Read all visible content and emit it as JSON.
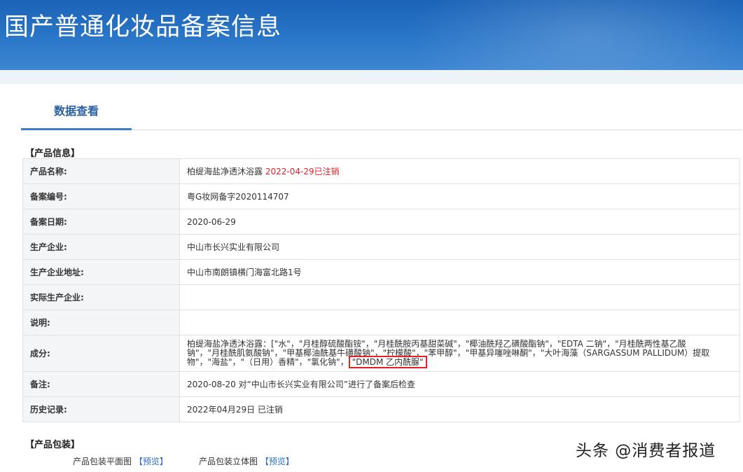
{
  "header": {
    "title": "国产普通化妆品备案信息"
  },
  "tabs": [
    {
      "label": "数据查看"
    }
  ],
  "product_info": {
    "section_title": "【产品信息】",
    "rows": [
      {
        "label": "产品名称:",
        "value": "柏缇海盐净透沐浴露",
        "status": "2022-04-29已注销"
      },
      {
        "label": "备案编号:",
        "value": "粤G妆网备字2020114707"
      },
      {
        "label": "备案日期:",
        "value": "2020-06-29"
      },
      {
        "label": "生产企业:",
        "value": "中山市长兴实业有限公司"
      },
      {
        "label": "生产企业地址:",
        "value": "中山市南朗镇横门海富北路1号"
      },
      {
        "label": "实际生产企业:",
        "value": ""
      },
      {
        "label": "说明:",
        "value": ""
      },
      {
        "label": "成分:",
        "value": "柏缇海盐净透沐浴露：[\"水\"，\"月桂醇硫酸酯铵\"，\"月桂酰胺丙基甜菜碱\"，\"椰油酰羟乙磺酸酯钠\"，\"EDTA 二钠\"，\"月桂酰两性基乙酸钠\"，\"月桂酰肌氨酸钠\"，\"甲基椰油酰基牛磺酸钠\"，\"柠檬酸\"，\"苯甲醇\"，\"甲基异噻唑啉酮\"，\"大叶海藻（SARGASSUM PALLIDUM）提取物\"，\"海盐\"，\"（日用）香精\"，\"氯化钠\"，",
        "highlight": "\"DMDM 乙内酰脲\""
      },
      {
        "label": "备注:",
        "value": "2020-08-20 对“中山市长兴实业有限公司”进行了备案后检查"
      },
      {
        "label": "历史记录:",
        "value": "2022年04月29日 已注销"
      }
    ]
  },
  "packaging": {
    "section_title": "【产品包装】",
    "items": [
      {
        "label": "产品包装平面图",
        "link": "【预览】"
      },
      {
        "label": "产品包装立体图",
        "link": "【预览】"
      }
    ]
  },
  "watermark": "头条 @消费者报道",
  "colors": {
    "banner": "#2a76c8",
    "accent": "#3b7dc4",
    "cancelled": "#e0212a",
    "link": "#2b6cc4"
  }
}
